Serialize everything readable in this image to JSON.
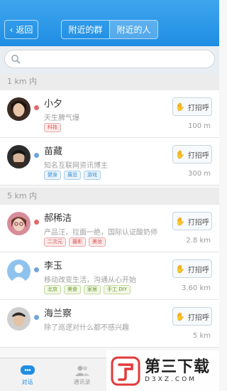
{
  "header": {
    "back_label": "返回",
    "tabs": [
      "附近的群",
      "附近的人"
    ],
    "active_tab": 1
  },
  "search": {
    "placeholder": ""
  },
  "sections": [
    "1 km 内",
    "5 km 内"
  ],
  "people": [
    {
      "name": "小夕",
      "gender": "female",
      "signature": "天生脾气爆",
      "tags": [
        {
          "text": "科技",
          "color": "red"
        }
      ],
      "distance": "100 m",
      "action": "打招呼"
    },
    {
      "name": "苗藏",
      "gender": "male",
      "signature": "知名互联网资讯博主",
      "tags": [
        {
          "text": "健身",
          "color": "blue"
        },
        {
          "text": "展览",
          "color": "blue"
        },
        {
          "text": "游戏",
          "color": "blue"
        }
      ],
      "distance": "300 m",
      "action": "打招呼"
    },
    {
      "name": "郝稀洁",
      "gender": "female",
      "signature": "产品汪，拉面一绝，国际认证酸奶师",
      "tags": [
        {
          "text": "二次元",
          "color": "red"
        },
        {
          "text": "摄影",
          "color": "red"
        },
        {
          "text": "美妆",
          "color": "red"
        }
      ],
      "distance": "2.8 km",
      "action": "打招呼"
    },
    {
      "name": "李玉",
      "gender": "male",
      "signature": "移动改变生活，沟通从心开始",
      "tags": [
        {
          "text": "北京",
          "color": "green"
        },
        {
          "text": "美食",
          "color": "green"
        },
        {
          "text": "家居",
          "color": "green"
        },
        {
          "text": "手工 DIY",
          "color": "green"
        }
      ],
      "distance": "3.60 km",
      "action": "打招呼"
    },
    {
      "name": "海兰察",
      "gender": "male",
      "signature": "除了巡逻对什么都不感兴趣",
      "tags": [],
      "distance": "5 km",
      "action": "打招呼"
    }
  ],
  "tabbar": [
    {
      "label": "对话",
      "icon": "chat-icon"
    },
    {
      "label": "通讯录",
      "icon": "contacts-icon"
    }
  ],
  "watermark": {
    "title": "第三下载",
    "url": "D3XZ.COM"
  },
  "colors": {
    "accent": "#1f8de3",
    "female": "#e16a6a",
    "male": "#6fa6d8"
  }
}
